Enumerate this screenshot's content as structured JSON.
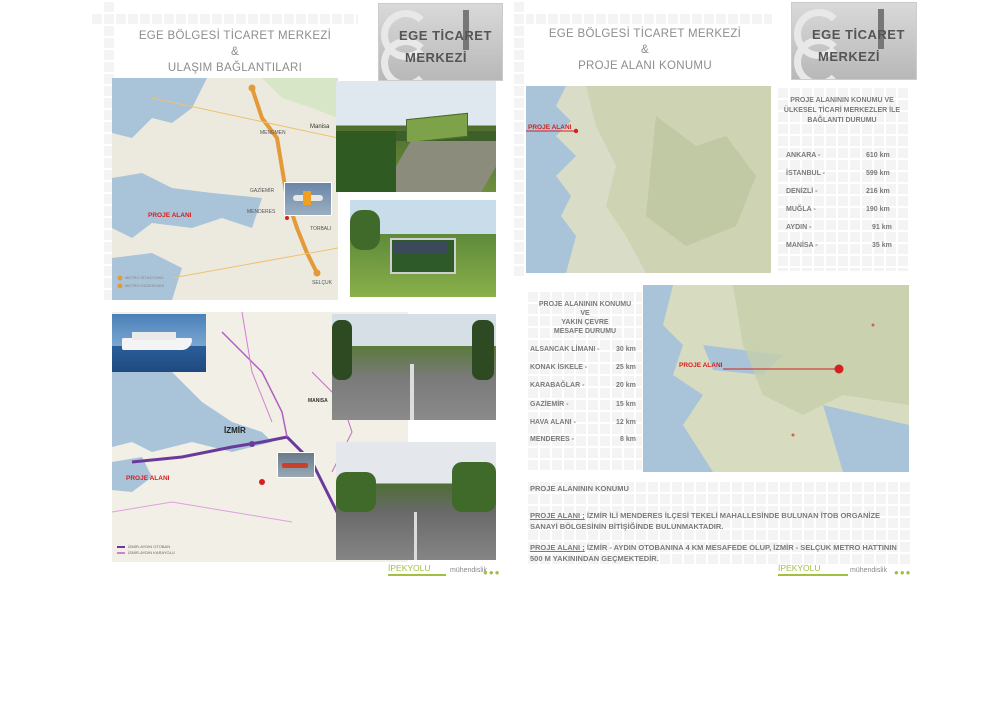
{
  "left_panel": {
    "title_line1": "EGE BÖLGESİ TİCARET MERKEZİ",
    "title_line2": "&",
    "title_line3": "ULAŞIM BAĞLANTILARI",
    "logo_line1": "EGE TİCARET",
    "logo_line2": "MERKEZİ",
    "map1_labels": [
      "MENEMEN",
      "Manisa",
      "GAZİEMİR",
      "MENDERES",
      "TORBALI",
      "SELÇUK"
    ],
    "map1_proje_label": "PROJE ALANI",
    "map1_legend": [
      "METRO İSTASYONU",
      "METRO GÜZERGAHI"
    ],
    "map2_city": "İZMİR",
    "map2_manisa": "MANISA",
    "map2_proje_label": "PROJE ALANI",
    "map2_legend": [
      "İZMİR-AYDIN OTOBAN",
      "İZMİR-AYDIN KARAYOLU"
    ],
    "footer_brand": "İPEKYOLU",
    "footer_text": "mühendislik"
  },
  "right_panel": {
    "title_line1": "EGE BÖLGESİ TİCARET MERKEZİ",
    "title_line2": "&",
    "title_line3": "PROJE ALANI KONUMU",
    "logo_line1": "EGE TİCARET",
    "logo_line2": "MERKEZİ",
    "regional_heading": "PROJE ALANININ KONUMU VE ÜLKESEL TİCARİ MERKEZLER İLE BAĞLANTI DURUMU",
    "regional_distances": [
      {
        "city": "ANKARA -",
        "km": "610 km"
      },
      {
        "city": "İSTANBUL -",
        "km": "599 km"
      },
      {
        "city": "DENİZLİ -",
        "km": "216 km"
      },
      {
        "city": "MUĞLA -",
        "km": "190 km"
      },
      {
        "city": "AYDIN -",
        "km": "91 km"
      },
      {
        "city": "MANİSA -",
        "km": "35 km"
      }
    ],
    "map3_proje_label": "PROJE ALANI",
    "local_heading_1": "PROJE ALANININ KONUMU",
    "local_heading_2": "VE",
    "local_heading_3": "YAKIN ÇEVRE",
    "local_heading_4": "MESAFE DURUMU",
    "local_distances": [
      {
        "place": "ALSANCAK LİMANI -",
        "km": "30 km"
      },
      {
        "place": "KONAK İSKELE -",
        "km": "25 km"
      },
      {
        "place": "KARABAĞLAR -",
        "km": "20 km"
      },
      {
        "place": "GAZİEMİR -",
        "km": "15 km"
      },
      {
        "place": "HAVA ALANI -",
        "km": "12 km"
      },
      {
        "place": "MENDERES -",
        "km": "8 km"
      }
    ],
    "map4_proje_label": "PROJE ALANI",
    "bottom_heading": "PROJE ALANININ KONUMU",
    "para1_label": "PROJE ALANI ;",
    "para1_text": "İZMİR İLİ MENDERES İLÇESİ TEKELİ MAHALLESİNDE BULUNAN İTOB ORGANİZE SANAYİ BÖLGESİNİN BİTİŞİĞİNDE BULUNMAKTADIR.",
    "para2_label": "PROJE ALANI ;",
    "para2_text": "İZMİR - AYDIN OTOBANINA 4 KM MESAFEDE OLUP, İZMİR - SELÇUK METRO HATTININ 500 M YAKININDAN GEÇMEKTEDİR.",
    "footer_brand": "İPEKYOLU",
    "footer_text": "mühendislik"
  },
  "colors": {
    "accent_red": "#d42020",
    "brand_green": "#a0c040",
    "route_orange": "#e39a3b",
    "route_purple": "#6a3a9a"
  }
}
